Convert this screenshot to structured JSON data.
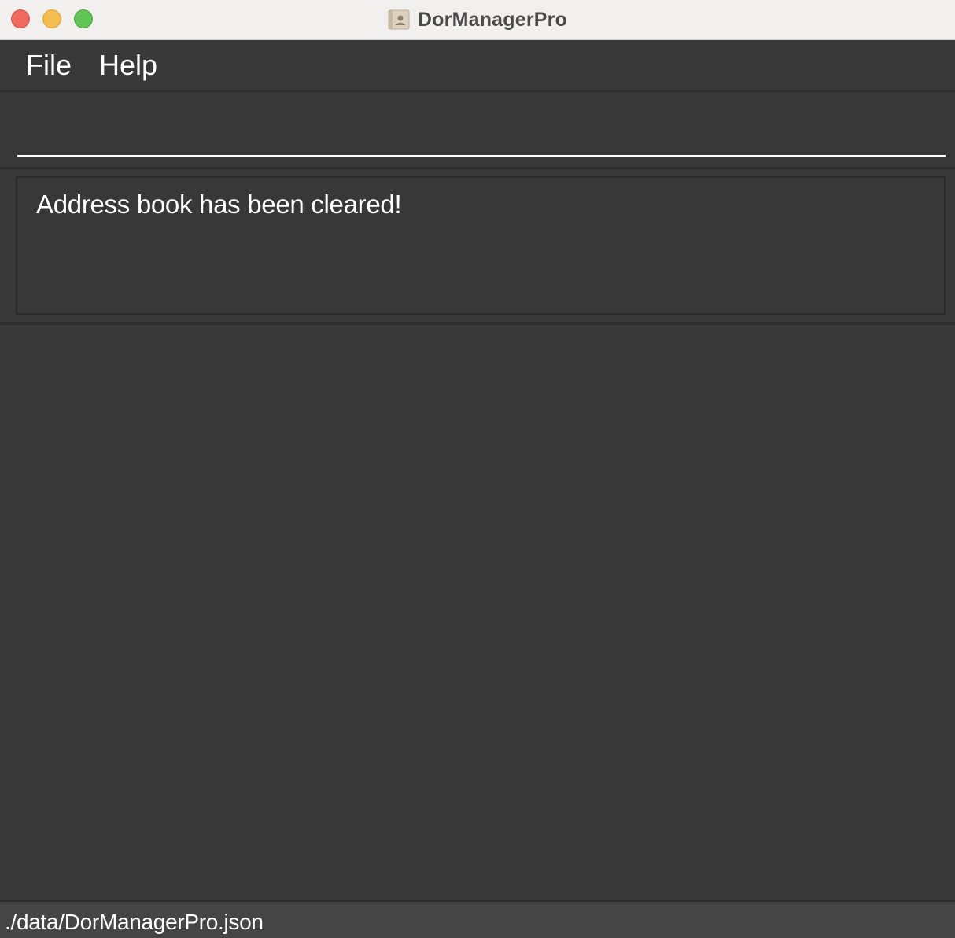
{
  "window": {
    "title": "DorManagerPro",
    "app_icon": "address-book-icon"
  },
  "menu": {
    "items": [
      {
        "label": "File"
      },
      {
        "label": "Help"
      }
    ]
  },
  "command_box": {
    "value": "",
    "placeholder": ""
  },
  "result_display": {
    "text": "Address book has been cleared!"
  },
  "person_list": {
    "items": []
  },
  "status_bar": {
    "file_path": "./data/DorManagerPro.json"
  },
  "colors": {
    "background": "#383838",
    "title_bar": "#f2f0ef",
    "status_bar": "#454545",
    "text": "#ffffff",
    "close": "#ee6a5f",
    "minimize": "#f5bd4f",
    "zoom": "#61c454"
  }
}
